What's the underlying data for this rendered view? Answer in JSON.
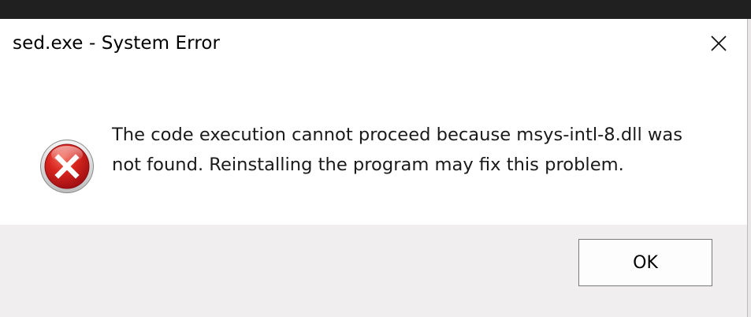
{
  "window": {
    "title": "sed.exe - System Error",
    "close_icon": "close-icon"
  },
  "dialog": {
    "icon": "error-icon",
    "message_line1": "The code execution cannot proceed because msys-intl-8.dll was",
    "message_line2": "not found. Reinstalling the program may fix this problem."
  },
  "buttons": {
    "ok_label": "OK"
  },
  "colors": {
    "error_icon_red": "#c4161c",
    "button_area_bg": "#f0eeef",
    "button_border": "#7a7a7a"
  }
}
